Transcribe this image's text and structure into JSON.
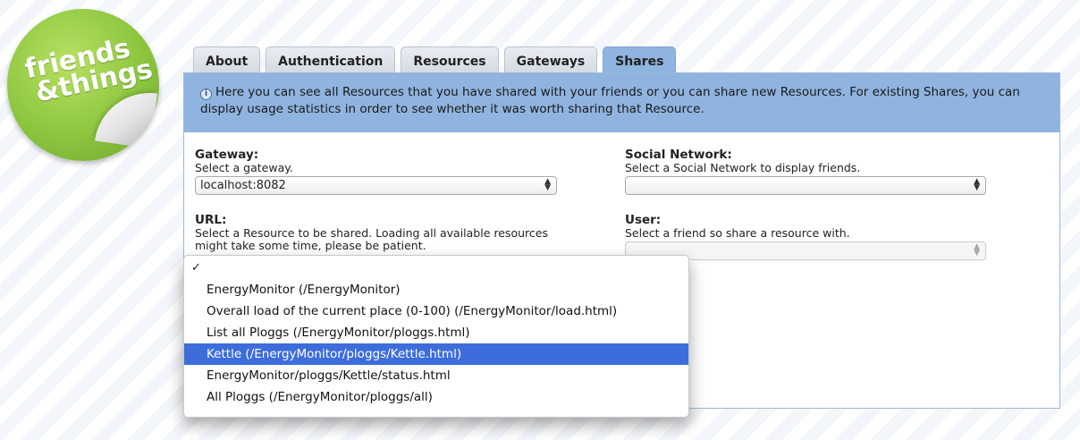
{
  "logo": {
    "line1": "friends",
    "line2": "&things"
  },
  "tabs": [
    {
      "label": "About"
    },
    {
      "label": "Authentication"
    },
    {
      "label": "Resources"
    },
    {
      "label": "Gateways"
    },
    {
      "label": "Shares",
      "active": true
    }
  ],
  "info": {
    "icon": "info-icon",
    "text": "Here you can see all Resources that you have shared with your friends or you can share new Resources. For existing Shares, you can display usage statistics in order to see whether it was worth sharing that Resource."
  },
  "gateway": {
    "label": "Gateway:",
    "hint": "Select a gateway.",
    "value": "localhost:8082"
  },
  "social": {
    "label": "Social Network:",
    "hint": "Select a Social Network to display friends.",
    "value": ""
  },
  "url": {
    "label": "URL:",
    "hint": "Select a Resource to be shared. Loading all available resources might take some time, please be patient."
  },
  "user": {
    "label": "User:",
    "hint": "Select a friend so share a resource with.",
    "value": ""
  },
  "menu": {
    "check": "✓",
    "items": [
      "EnergyMonitor (/EnergyMonitor)",
      "Overall load of the current place (0-100) (/EnergyMonitor/load.html)",
      "List all Ploggs (/EnergyMonitor/ploggs.html)",
      "Kettle (/EnergyMonitor/ploggs/Kettle.html)",
      "EnergyMonitor/ploggs/Kettle/status.html",
      "All Ploggs (/EnergyMonitor/ploggs/all)"
    ],
    "selected_index": 3
  },
  "colors": {
    "accent": "#8fb4df",
    "selection": "#3d6ddb",
    "logo": "#8cc63f"
  }
}
